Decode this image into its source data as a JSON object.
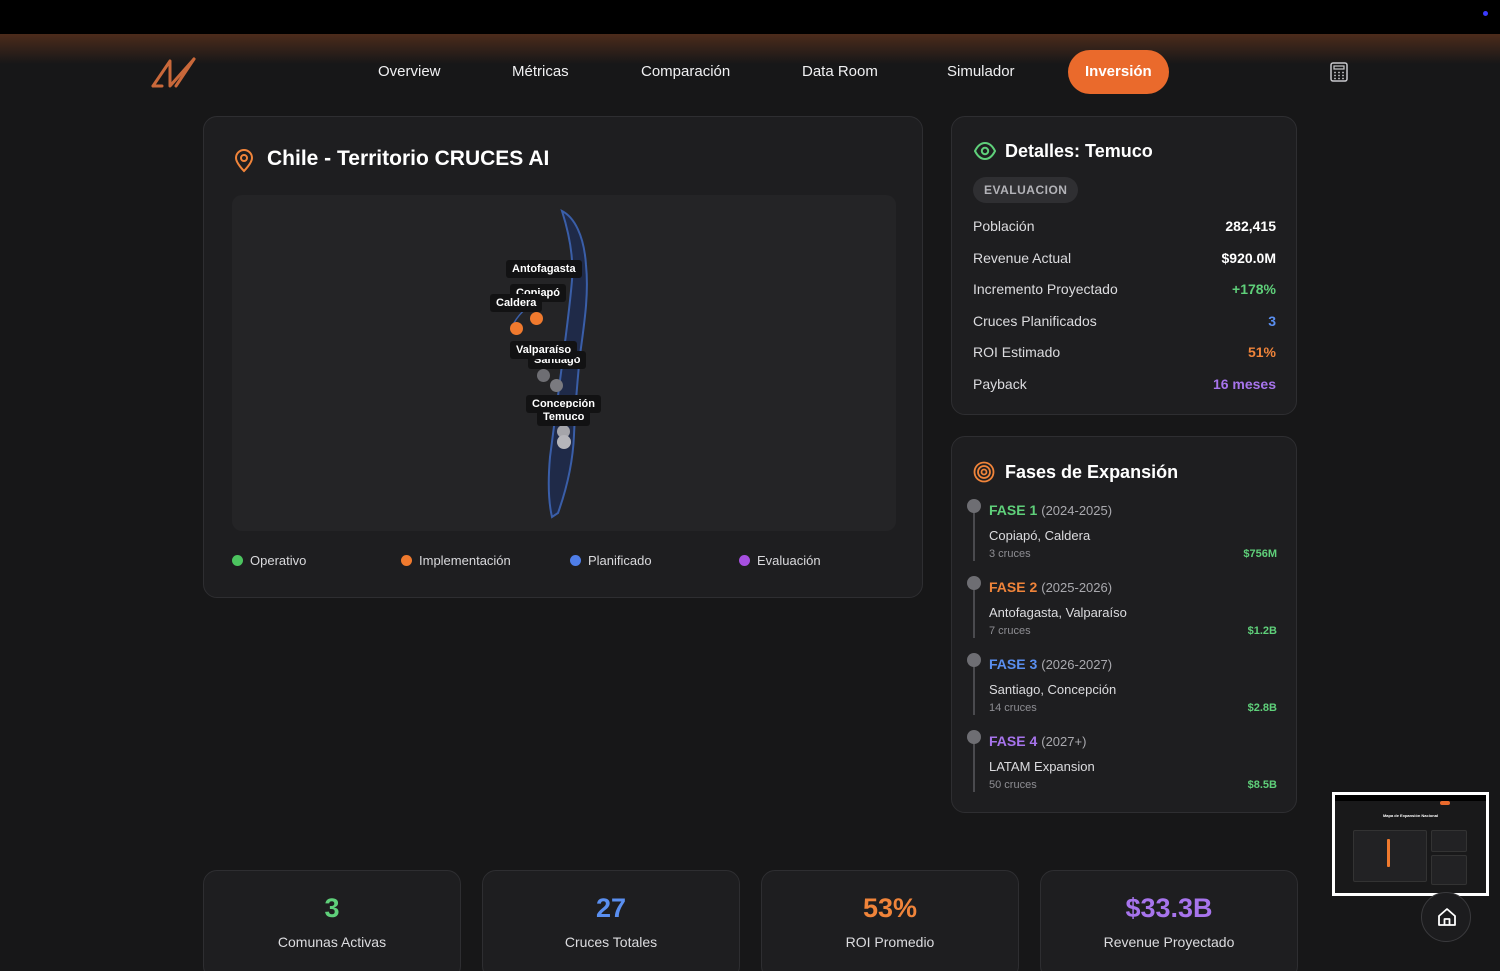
{
  "nav": {
    "items": [
      {
        "label": "Overview"
      },
      {
        "label": "Métricas"
      },
      {
        "label": "Comparación"
      },
      {
        "label": "Data Room"
      },
      {
        "label": "Simulador"
      },
      {
        "label": "Inversión",
        "active": true
      }
    ],
    "logo_icon": "brand-logo-icon",
    "calculator_icon": "calculator-icon"
  },
  "map": {
    "title": "Chile - Territorio CRUCES AI",
    "cities": [
      {
        "name": "Antofagasta",
        "status": "Implementación"
      },
      {
        "name": "Copiapó",
        "status": "Implementación"
      },
      {
        "name": "Caldera",
        "status": "Implementación"
      },
      {
        "name": "Valparaíso",
        "status": "Evaluación"
      },
      {
        "name": "Santiago",
        "status": "Evaluación"
      },
      {
        "name": "Concepción",
        "status": "Evaluación"
      },
      {
        "name": "Temuco",
        "status": "Evaluación"
      }
    ],
    "legend": [
      {
        "label": "Operativo",
        "color": "#4cc45f"
      },
      {
        "label": "Implementación",
        "color": "#f07a2e"
      },
      {
        "label": "Planificado",
        "color": "#4f7ee8"
      },
      {
        "label": "Evaluación",
        "color": "#a64fe0"
      }
    ]
  },
  "details": {
    "title": "Detalles: Temuco",
    "badge": "EVALUACION",
    "rows": [
      {
        "label": "Población",
        "value": "282,415",
        "color": "#ffffff"
      },
      {
        "label": "Revenue Actual",
        "value": "$920.0M",
        "color": "#ffffff"
      },
      {
        "label": "Incremento Proyectado",
        "value": "+178%",
        "color": "#5fd07a"
      },
      {
        "label": "Cruces Planificados",
        "value": "3",
        "color": "#5a8ff0"
      },
      {
        "label": "ROI Estimado",
        "value": "51%",
        "color": "#f0843a"
      },
      {
        "label": "Payback",
        "value": "16 meses",
        "color": "#a774ec"
      }
    ]
  },
  "fases": {
    "title": "Fases de Expansión",
    "items": [
      {
        "name": "FASE 1",
        "years": "(2024-2025)",
        "cities": "Copiapó, Caldera",
        "cruces": "3 cruces",
        "amount": "$756M",
        "color": "#5fd07a"
      },
      {
        "name": "FASE 2",
        "years": "(2025-2026)",
        "cities": "Antofagasta, Valparaíso",
        "cruces": "7 cruces",
        "amount": "$1.2B",
        "color": "#f0843a"
      },
      {
        "name": "FASE 3",
        "years": "(2026-2027)",
        "cities": "Santiago, Concepción",
        "cruces": "14 cruces",
        "amount": "$2.8B",
        "color": "#5a8ff0"
      },
      {
        "name": "FASE 4",
        "years": "(2027+)",
        "cities": "LATAM Expansion",
        "cruces": "50 cruces",
        "amount": "$8.5B",
        "color": "#a774ec"
      }
    ]
  },
  "stats": [
    {
      "value": "3",
      "label": "Comunas Activas",
      "color": "#5fd07a"
    },
    {
      "value": "27",
      "label": "Cruces Totales",
      "color": "#5a8ff0"
    },
    {
      "value": "53%",
      "label": "ROI Promedio",
      "color": "#f0843a"
    },
    {
      "value": "$33.3B",
      "label": "Revenue Proyectado",
      "color": "#a774ec"
    }
  ],
  "thumbnail": {
    "title": "Mapa de Expansión Nacional"
  }
}
